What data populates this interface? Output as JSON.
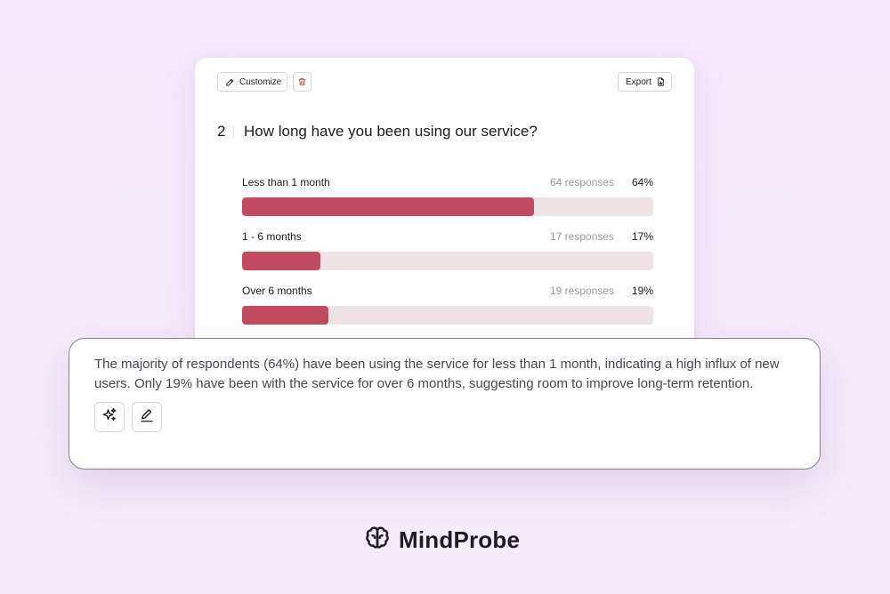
{
  "toolbar": {
    "customize_label": "Customize",
    "export_label": "Export",
    "icons": {
      "customize": "pencil-icon",
      "delete": "trash-icon",
      "export": "file-export-icon"
    },
    "delete_icon_color": "#c24b5f"
  },
  "question": {
    "number": "2",
    "text": "How long have you been using our service?"
  },
  "options": [
    {
      "label": "Less than 1 month",
      "responses": "64 responses",
      "percent": "64%",
      "fill_fraction": 0.71
    },
    {
      "label": "1 - 6 months",
      "responses": "17 responses",
      "percent": "17%",
      "fill_fraction": 0.19
    },
    {
      "label": "Over 6 months",
      "responses": "19 responses",
      "percent": "19%",
      "fill_fraction": 0.21
    }
  ],
  "colors": {
    "bar_fill": "#c24b5f",
    "bar_track": "#efe3e5",
    "background": "#f6e9fb"
  },
  "summary": {
    "text": "The majority of respondents (64%) have been using the service for less than 1 month, indicating a high influx of new users. Only 19% have been with the service for over 6 months, suggesting room to improve long-term retention.",
    "tools": [
      "sparkles-icon",
      "pencil-icon"
    ]
  },
  "brand": {
    "name": "MindProbe",
    "logo_icon": "brain-icon"
  }
}
